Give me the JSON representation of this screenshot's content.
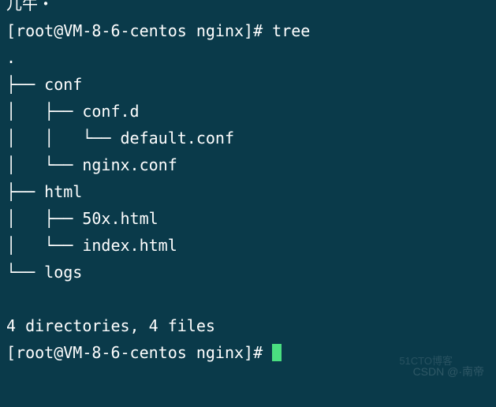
{
  "top_partial": "儿牛・",
  "prompt1": {
    "open": "[",
    "user": "root@VM-8-6-centos nginx",
    "close": "]# ",
    "command": "tree"
  },
  "tree": {
    "dot": ".",
    "l1": "├── conf",
    "l2": "│   ├── conf.d",
    "l3": "│   │   └── default.conf",
    "l4": "│   └── nginx.conf",
    "l5": "├── html",
    "l6": "│   ├── 50x.html",
    "l7": "│   └── index.html",
    "l8": "└── logs"
  },
  "summary": "4 directories, 4 files",
  "prompt2": {
    "open": "[",
    "user": "root@VM-8-6-centos nginx",
    "close": "]# "
  },
  "watermark": "CSDN @·南帝",
  "watermark2": "51CTO博客"
}
